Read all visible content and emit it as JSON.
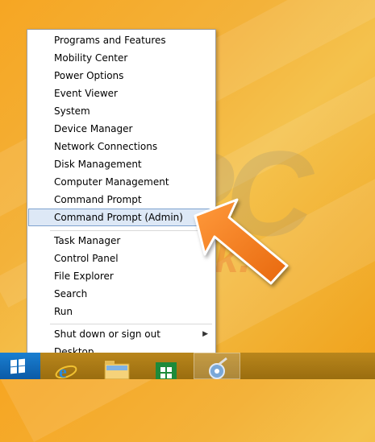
{
  "menu": {
    "group1": [
      "Programs and Features",
      "Mobility Center",
      "Power Options",
      "Event Viewer",
      "System",
      "Device Manager",
      "Network Connections",
      "Disk Management",
      "Computer Management",
      "Command Prompt",
      "Command Prompt (Admin)"
    ],
    "group2": [
      "Task Manager",
      "Control Panel",
      "File Explorer",
      "Search",
      "Run"
    ],
    "group3": [
      "Shut down or sign out",
      "Desktop"
    ],
    "selected_item": "Command Prompt (Admin)"
  },
  "watermark": {
    "pc": "PC",
    "risk": "risk.c"
  },
  "taskbar": {
    "items": [
      "start-button-icon",
      "internet-explorer-icon",
      "file-explorer-icon",
      "store-icon",
      "settings-icon"
    ]
  },
  "colors": {
    "desktop_background": "#f3b23a",
    "menu_selection": "#dde8f6",
    "menu_selection_border": "#7da2ce",
    "arrow": "#f07d1e",
    "start_button": "#1a7fd1"
  }
}
